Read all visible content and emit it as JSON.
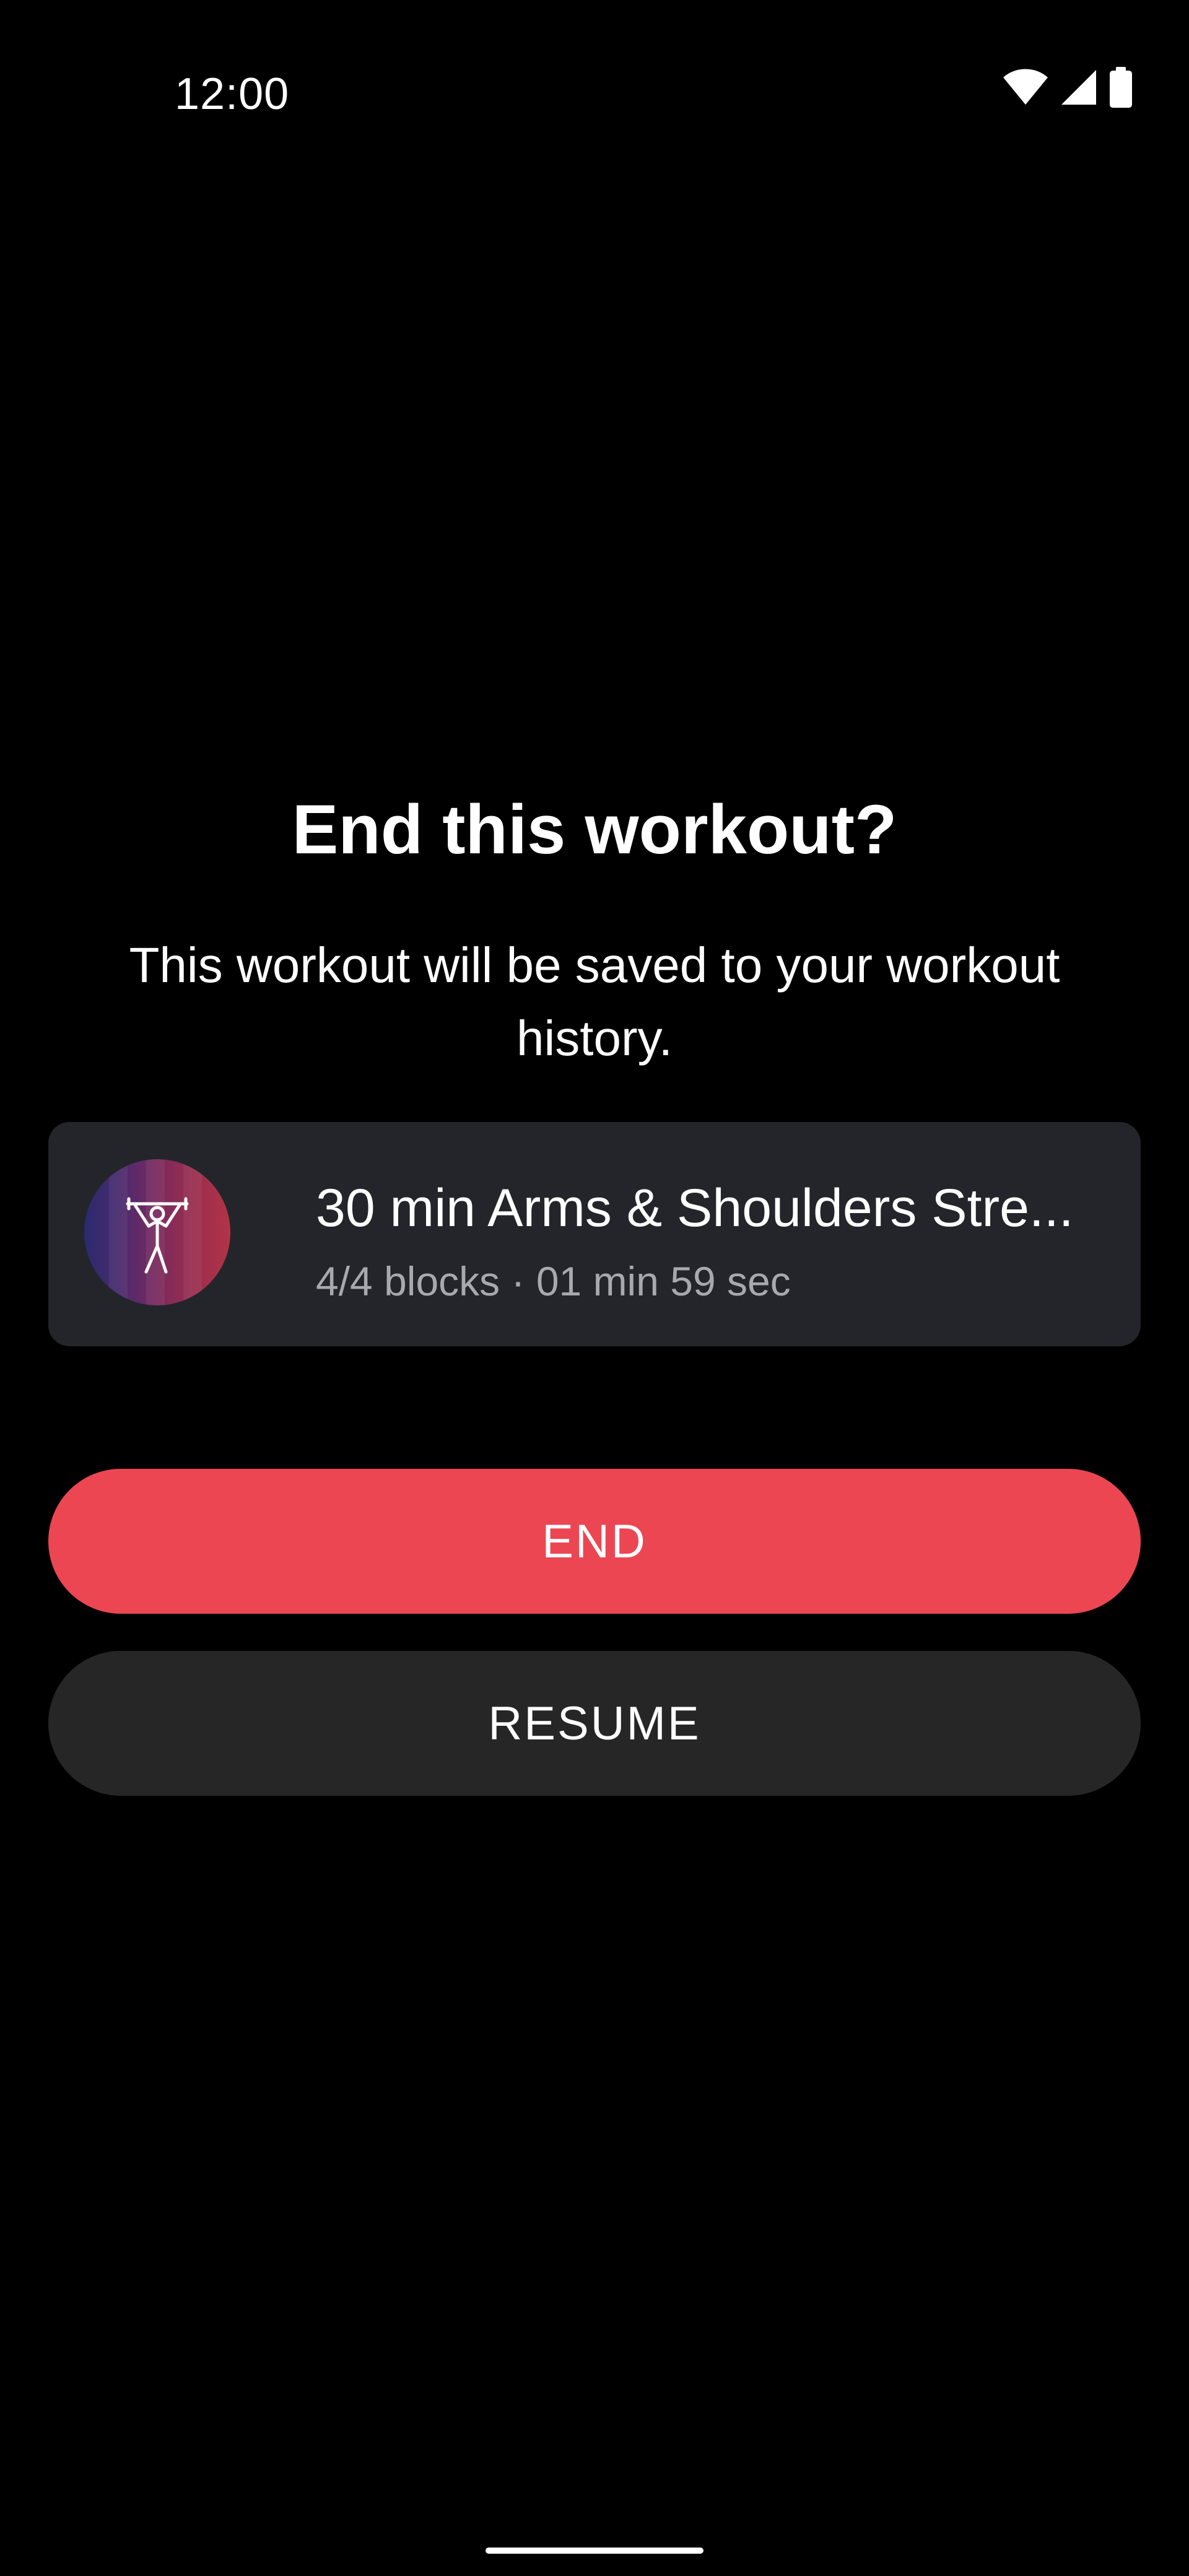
{
  "status_bar": {
    "time": "12:00"
  },
  "dialog": {
    "title": "End this workout?",
    "message": "This workout will be saved to your workout history."
  },
  "workout": {
    "name": "30 min Arms & Shoulders Stre...",
    "meta": "4/4 blocks · 01 min 59 sec",
    "thumbnail_icon": "weightlifter-icon"
  },
  "actions": {
    "end_label": "END",
    "resume_label": "RESUME"
  },
  "colors": {
    "background": "#000000",
    "card": "#23252b",
    "end_button": "#ec4653",
    "resume_button": "#262626",
    "secondary_text": "#a7a9ae"
  }
}
